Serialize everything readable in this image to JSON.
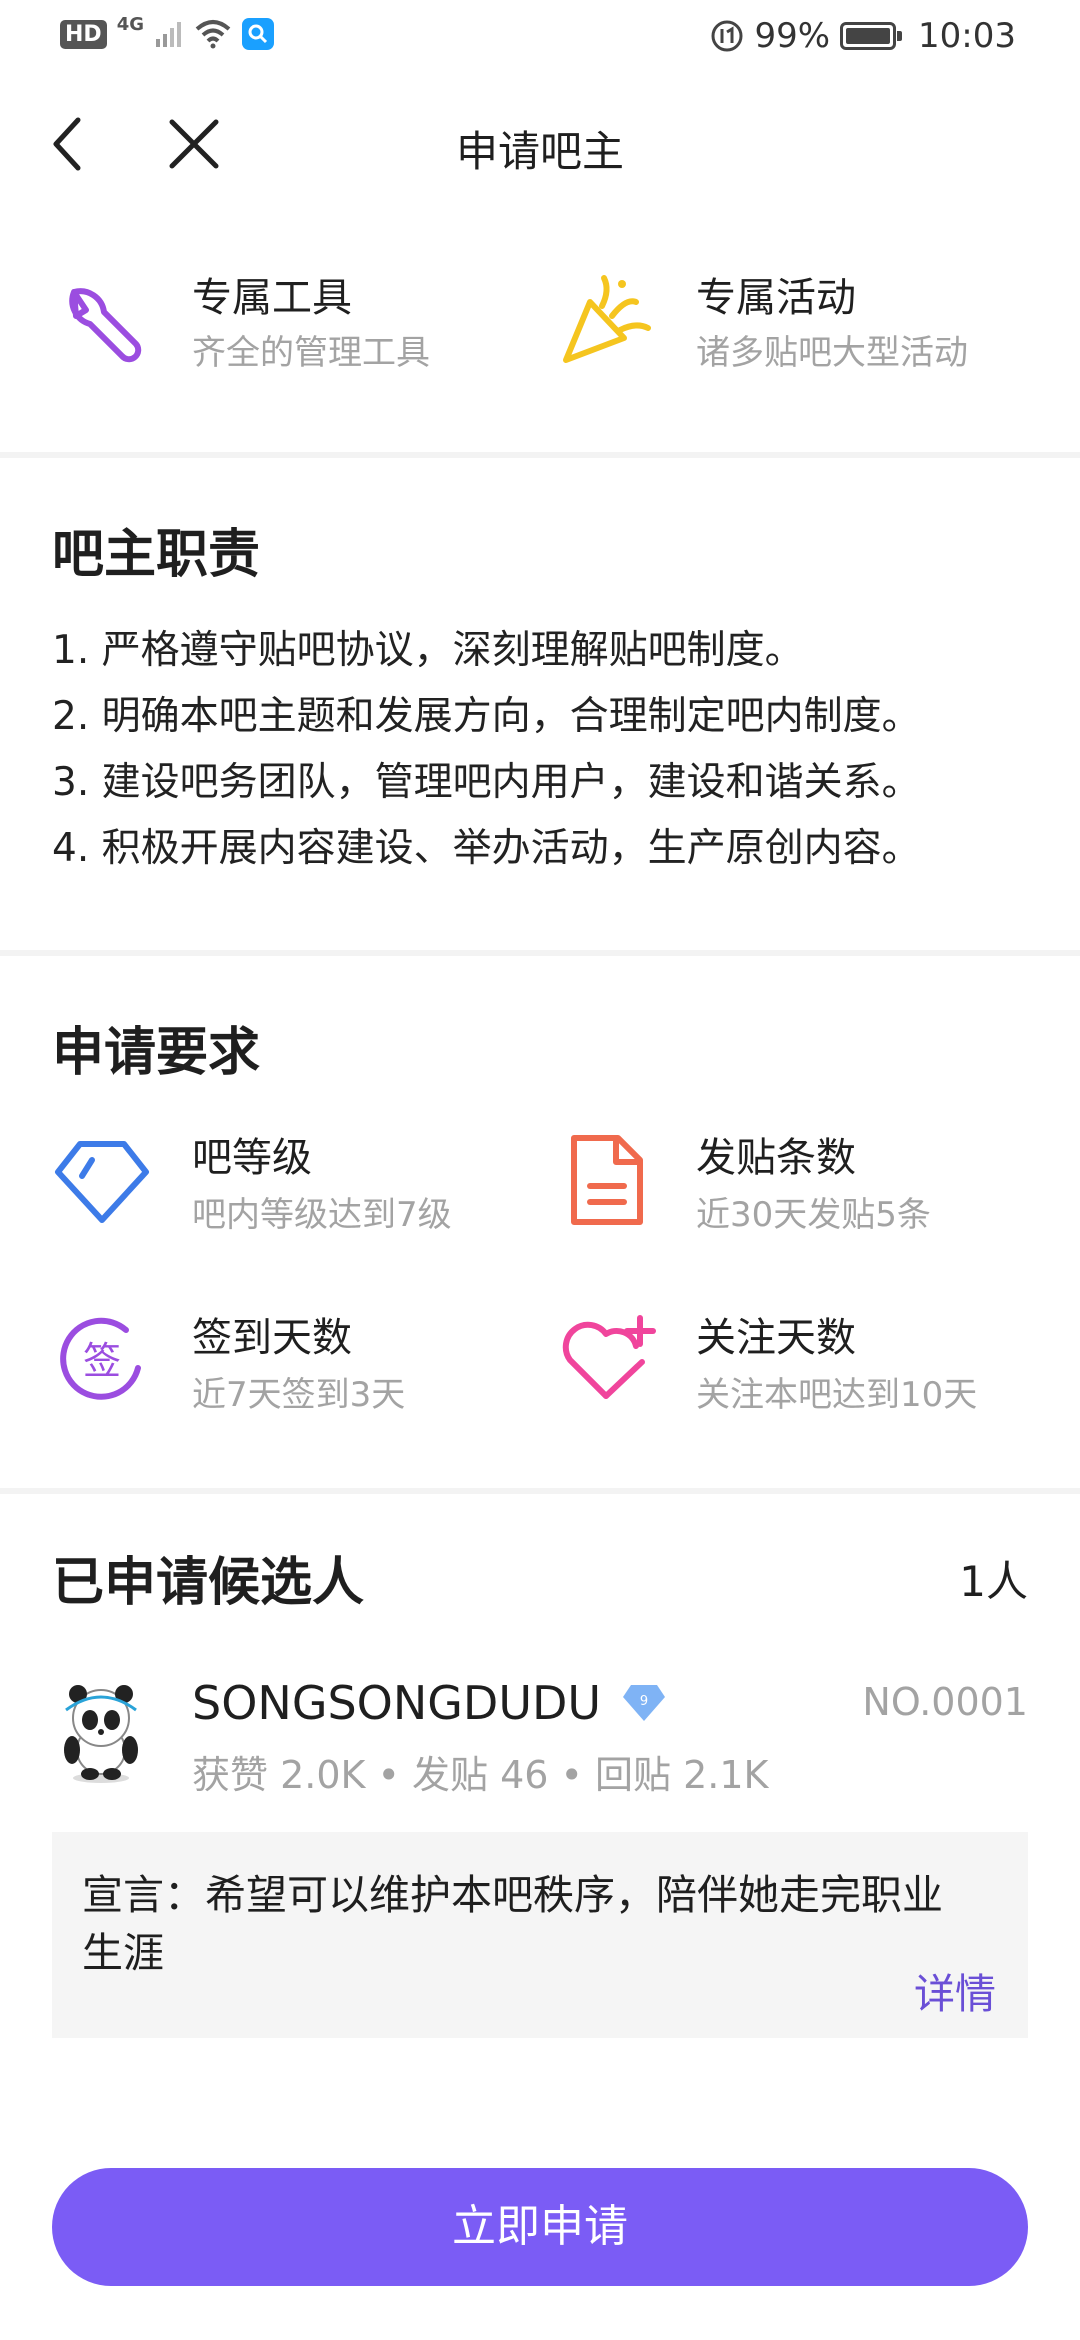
{
  "status_bar": {
    "hd": "HD",
    "network": "4G",
    "battery_percent": "99%",
    "time": "10:03",
    "battery_level": 0.99
  },
  "nav": {
    "title": "申请吧主"
  },
  "features": [
    {
      "title": "专属工具",
      "subtitle": "齐全的管理工具",
      "icon": "wrench-icon"
    },
    {
      "title": "专属活动",
      "subtitle": "诸多贴吧大型活动",
      "icon": "party-popper-icon"
    }
  ],
  "duties": {
    "title": "吧主职责",
    "items": [
      "1. 严格遵守贴吧协议，深刻理解贴吧制度。",
      "2. 明确本吧主题和发展方向，合理制定吧内制度。",
      "3. 建设吧务团队，管理吧内用户，建设和谐关系。",
      "4. 积极开展内容建设、举办活动，生产原创内容。"
    ]
  },
  "requirements": {
    "title": "申请要求",
    "items": [
      {
        "title": "吧等级",
        "subtitle": "吧内等级达到7级",
        "icon": "diamond-icon"
      },
      {
        "title": "发贴条数",
        "subtitle": "近30天发贴5条",
        "icon": "document-icon"
      },
      {
        "title": "签到天数",
        "subtitle": "近7天签到3天",
        "icon": "sign-in-icon",
        "icon_text": "签"
      },
      {
        "title": "关注天数",
        "subtitle": "关注本吧达到10天",
        "icon": "heart-plus-icon"
      }
    ]
  },
  "candidates": {
    "title": "已申请候选人",
    "count": "1人",
    "list": [
      {
        "name": "SONGSONGDUDU",
        "level": "9",
        "number": "NO.0001",
        "stats": "获赞 2.0K • 发贴 46 • 回贴 2.1K",
        "manifesto": "宣言：希望可以维护本吧秩序，陪伴她走完职业生涯",
        "more": "详情"
      }
    ]
  },
  "apply_button": "立即申请",
  "colors": {
    "accent": "#7b5cf5",
    "link": "#6a4fd6",
    "wrench": "#9b4de0",
    "popper": "#f5c51f",
    "diamond": "#3d7be8",
    "document": "#f06a4d",
    "sign": "#9b4de0",
    "heart": "#f0459c"
  }
}
